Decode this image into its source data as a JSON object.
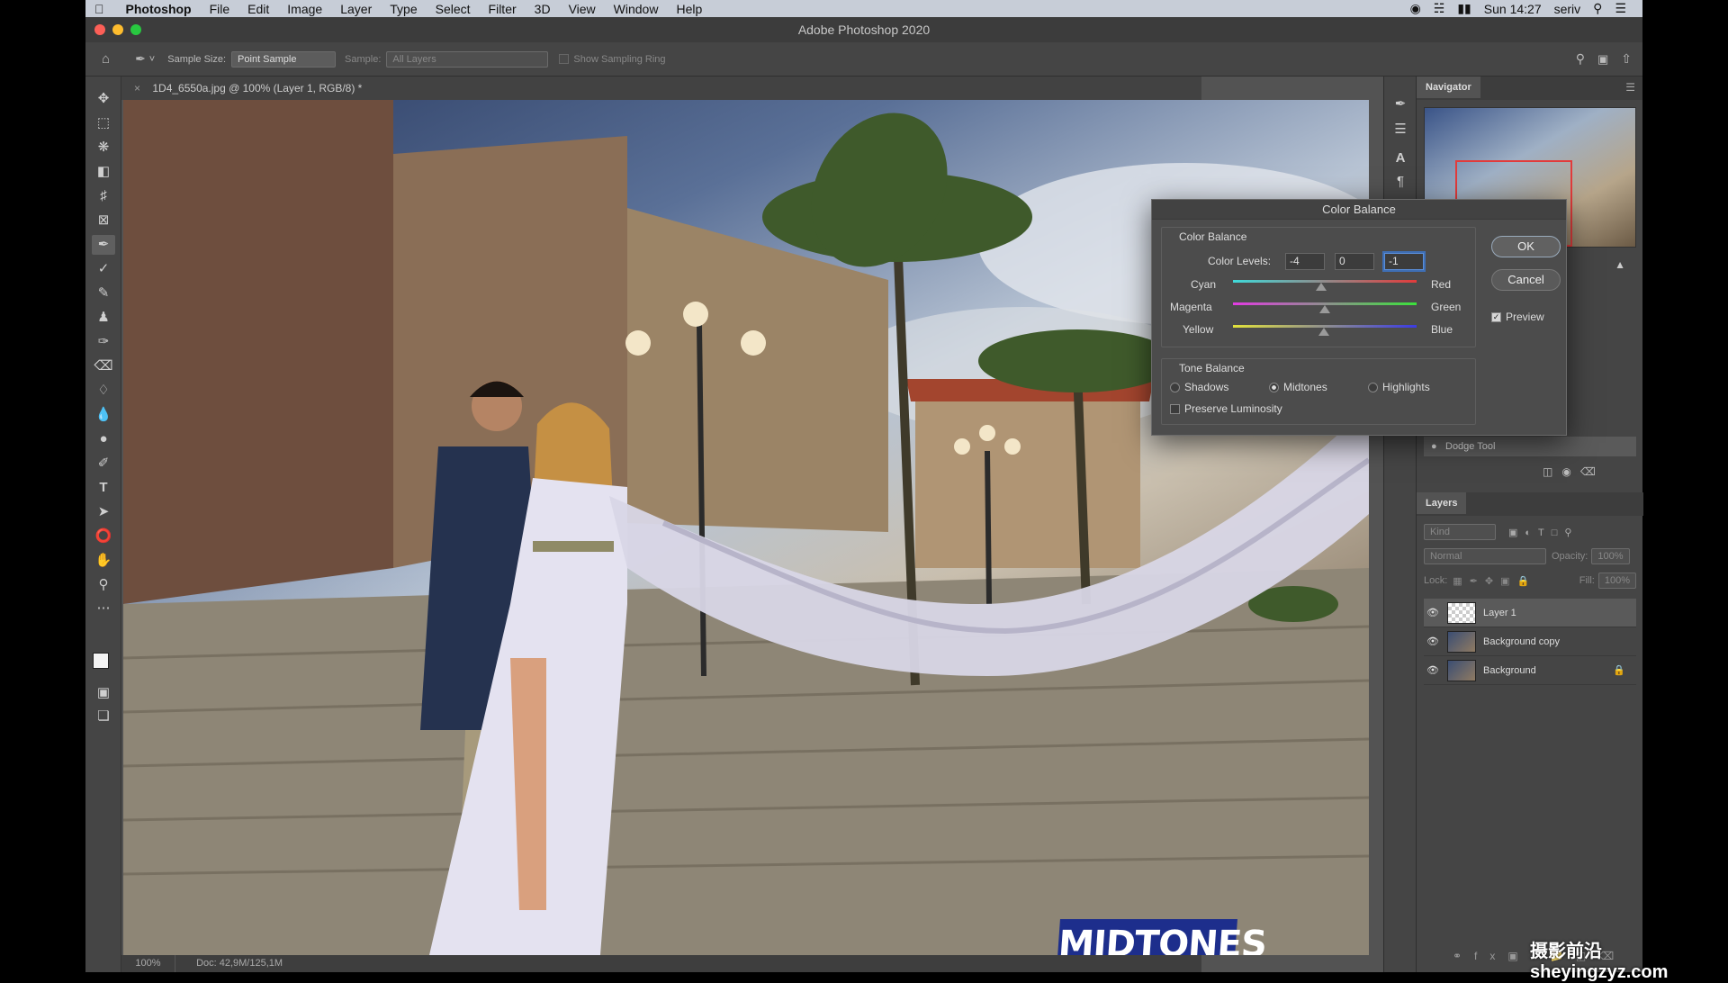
{
  "menubar": {
    "app": "Photoshop",
    "items": [
      "File",
      "Edit",
      "Image",
      "Layer",
      "Type",
      "Select",
      "Filter",
      "3D",
      "View",
      "Window",
      "Help"
    ],
    "clock": "Sun 14:27",
    "user": "seriv"
  },
  "window": {
    "title": "Adobe Photoshop 2020"
  },
  "options": {
    "sample_size_label": "Sample Size:",
    "sample_size_value": "Point Sample",
    "sample_label": "Sample:",
    "sample_value": "All Layers",
    "show_ring": "Show Sampling Ring"
  },
  "document": {
    "tab_title": "1D4_6550a.jpg @ 100% (Layer 1, RGB/8) *",
    "zoom": "100%",
    "doc_size": "Doc: 42,9M/125,1M"
  },
  "overlay_text": "MIDTONES",
  "watermark": "摄影前沿 sheyingzyz.com",
  "panels": {
    "navigator": "Navigator",
    "history_item": "Dodge Tool",
    "layers_tab": "Layers",
    "kind": "Kind",
    "blend_mode": "Normal",
    "opacity_label": "Opacity:",
    "opacity_value": "100%",
    "lock_label": "Lock:",
    "fill_label": "Fill:",
    "fill_value": "100%",
    "layers": [
      {
        "name": "Layer 1"
      },
      {
        "name": "Background copy"
      },
      {
        "name": "Background"
      }
    ]
  },
  "color_balance": {
    "title": "Color Balance",
    "section": "Color Balance",
    "levels_label": "Color Levels:",
    "levels": [
      "-4",
      "0",
      "-1"
    ],
    "left_labels": [
      "Cyan",
      "Magenta",
      "Yellow"
    ],
    "right_labels": [
      "Red",
      "Green",
      "Blue"
    ],
    "slider_positions": [
      -4,
      0,
      -1
    ],
    "tone_section": "Tone Balance",
    "tones": [
      "Shadows",
      "Midtones",
      "Highlights"
    ],
    "selected_tone": "Midtones",
    "preserve": "Preserve Luminosity",
    "ok": "OK",
    "cancel": "Cancel",
    "preview": "Preview"
  }
}
